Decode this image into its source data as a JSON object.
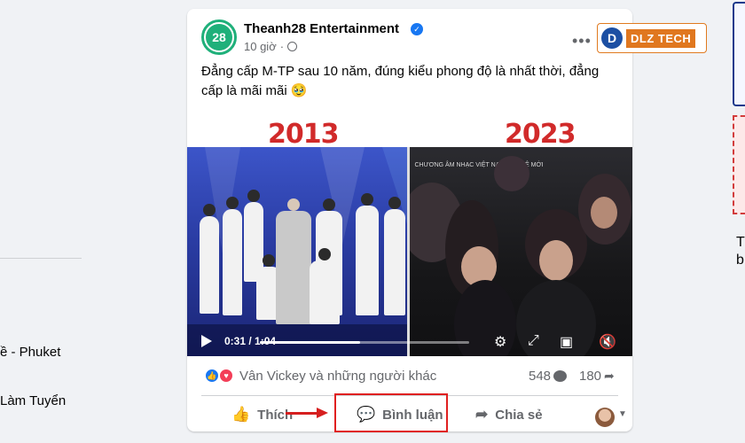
{
  "left_sidebar": {
    "item1": "ề - Phuket",
    "item2": "Làm Tuyển"
  },
  "right_edge": {
    "text1": "T",
    "text2": "b"
  },
  "watermark": {
    "mark": "D",
    "text": "DLZ TECH"
  },
  "post": {
    "page_name": "Theanh28 Entertainment",
    "avatar_text": "28",
    "time": "10 giờ",
    "more_label": "•••",
    "caption": "Đẳng cấp M-TP sau 10 năm, đúng kiểu phong độ là nhất thời, đẳng cấp là mãi mãi 🥹",
    "media": {
      "year_left": "2013",
      "year_right": "2023",
      "ticker": "CHƯƠNG ÂM NHẠC VIỆT NAM THẾ HỆ MỚI",
      "time_display": "0:31 / 1:04",
      "progress": 0.48
    },
    "reactions": {
      "names": "Vân Vickey và những người khác",
      "comments": "548",
      "shares": "180"
    },
    "actions": {
      "like": "Thích",
      "comment": "Bình luận",
      "share": "Chia sẻ"
    }
  },
  "colors": {
    "accent_blue": "#1877f2",
    "highlight_red": "#e02020",
    "brand_green": "#1fb07a",
    "year_red": "#d12a2a"
  }
}
